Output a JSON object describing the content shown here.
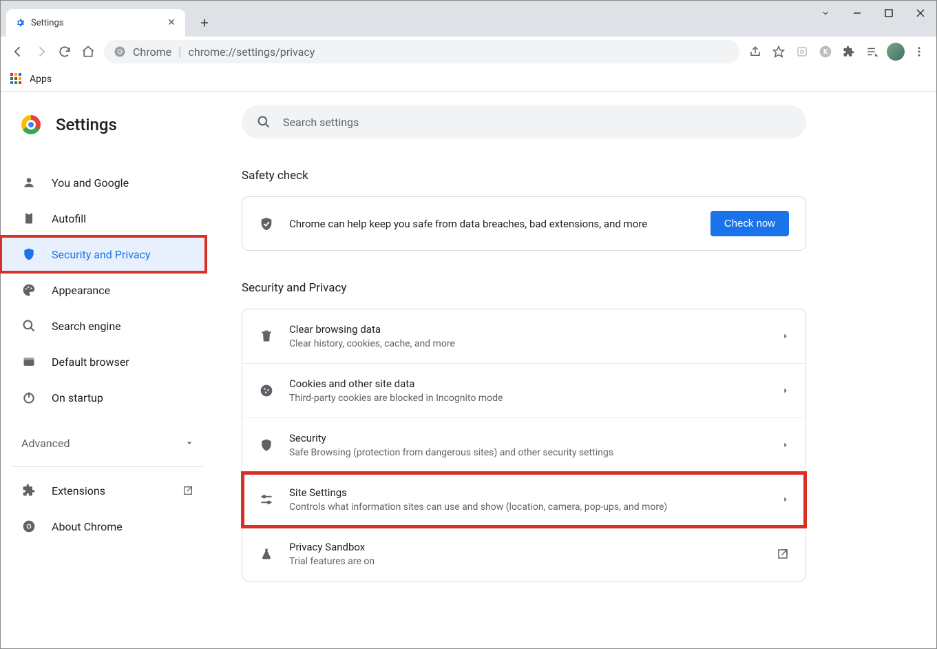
{
  "tab": {
    "title": "Settings"
  },
  "omnibox": {
    "prefix": "Chrome",
    "url": "chrome://settings/privacy"
  },
  "bookmarks": {
    "apps": "Apps"
  },
  "header": {
    "title": "Settings"
  },
  "search": {
    "placeholder": "Search settings"
  },
  "sidebar": {
    "items": [
      {
        "label": "You and Google"
      },
      {
        "label": "Autofill"
      },
      {
        "label": "Security and Privacy"
      },
      {
        "label": "Appearance"
      },
      {
        "label": "Search engine"
      },
      {
        "label": "Default browser"
      },
      {
        "label": "On startup"
      }
    ],
    "advanced": "Advanced",
    "extensions": "Extensions",
    "about": "About Chrome"
  },
  "sections": {
    "safety": {
      "title": "Safety check",
      "desc": "Chrome can help keep you safe from data breaches, bad extensions, and more",
      "button": "Check now"
    },
    "privacy": {
      "title": "Security and Privacy",
      "rows": [
        {
          "title": "Clear browsing data",
          "desc": "Clear history, cookies, cache, and more"
        },
        {
          "title": "Cookies and other site data",
          "desc": "Third-party cookies are blocked in Incognito mode"
        },
        {
          "title": "Security",
          "desc": "Safe Browsing (protection from dangerous sites) and other security settings"
        },
        {
          "title": "Site Settings",
          "desc": "Controls what information sites can use and show (location, camera, pop-ups, and more)"
        },
        {
          "title": "Privacy Sandbox",
          "desc": "Trial features are on"
        }
      ]
    }
  }
}
